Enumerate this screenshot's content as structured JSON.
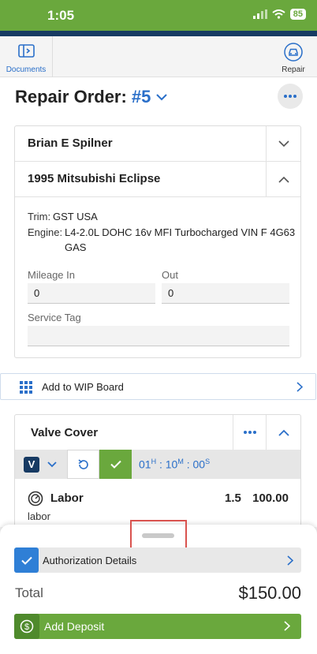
{
  "status_bar": {
    "time": "1:05",
    "battery": "85"
  },
  "toolbar": {
    "documents_label": "Documents",
    "repair_label": "Repair"
  },
  "header": {
    "title": "Repair Order:",
    "order_number": "#5"
  },
  "customer": {
    "name": "Brian E Spilner"
  },
  "vehicle": {
    "name": "1995 Mitsubishi Eclipse",
    "trim_label": "Trim:",
    "trim_value": "GST USA",
    "engine_label": "Engine:",
    "engine_value_line1": "L4-2.0L DOHC 16v MFI Turbocharged VIN F 4G63",
    "engine_value_line2": "GAS",
    "mileage_in_label": "Mileage In",
    "mileage_in_value": "0",
    "out_label": "Out",
    "out_value": "0",
    "service_tag_label": "Service Tag",
    "service_tag_value": ""
  },
  "wip": {
    "label": "Add to WIP Board"
  },
  "job": {
    "title": "Valve Cover",
    "badge": "V",
    "timer_hours": "01",
    "timer_h_unit": "H",
    "timer_minutes": "10",
    "timer_m_unit": "M",
    "timer_seconds": "00",
    "timer_s_unit": "S",
    "line_title": "Labor",
    "line_sub": "labor",
    "line_qty": "1.5",
    "line_amount": "100.00"
  },
  "sheet": {
    "auth_label": "Authorization Details",
    "total_label": "Total",
    "total_value": "$150.00",
    "deposit_label": "Add Deposit"
  },
  "colors": {
    "brand_green": "#6aa83d",
    "brand_navy": "#173a63",
    "accent_blue": "#2a6fc9",
    "highlight_red": "#d9534f"
  }
}
